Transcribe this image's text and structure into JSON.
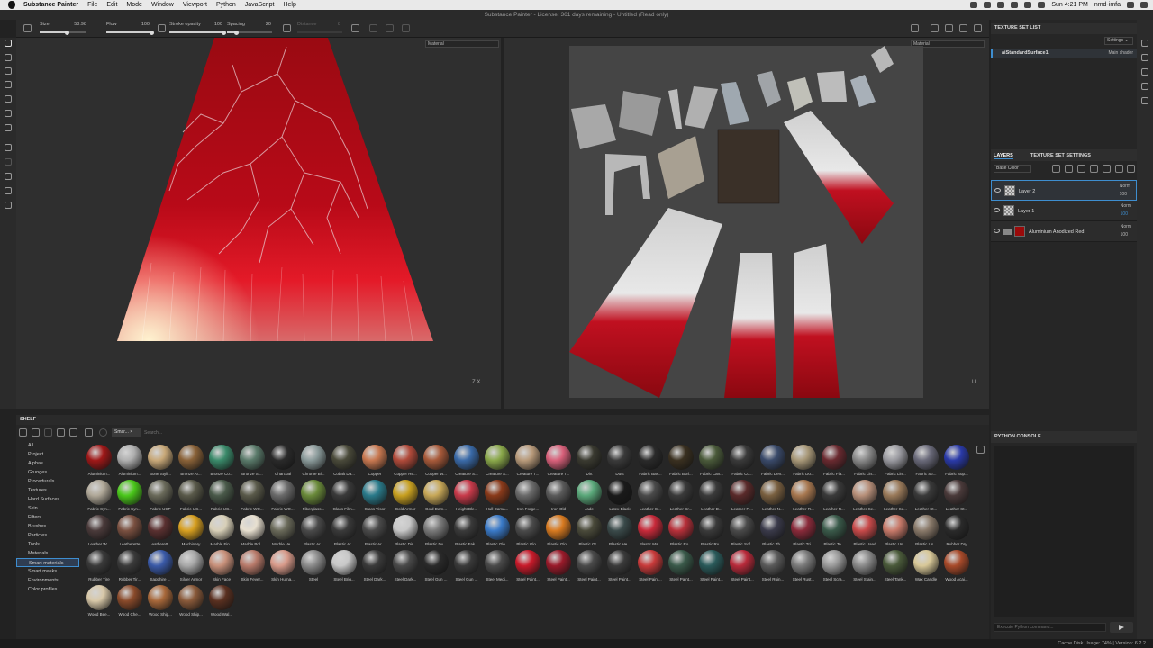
{
  "os_menu": {
    "app": "Substance Painter",
    "items": [
      "File",
      "Edit",
      "Mode",
      "Window",
      "Viewport",
      "Python",
      "JavaScript",
      "Help"
    ],
    "clock": "Sun 4:21 PM",
    "user": "nmd-imfa"
  },
  "window_title": "Substance Painter - License: 361 days remaining - Untitled (Read only)",
  "toolbar": {
    "size_label": "Size",
    "size_value": "58.98",
    "size_level": 0.58,
    "flow_label": "Flow",
    "flow_value": "100",
    "flow_level": 1.0,
    "stroke_label": "Stroke opacity",
    "stroke_value": "100",
    "stroke_level": 1.0,
    "spacing_label": "Spacing",
    "spacing_value": "20",
    "spacing_level": 0.2,
    "distance_label": "Distance",
    "distance_value": "8"
  },
  "viewport3d": {
    "dropdown": "Material",
    "axes": "Z  X"
  },
  "viewport2d": {
    "dropdown": "Material",
    "axes": "U"
  },
  "texture_set_list": {
    "title": "TEXTURE SET LIST",
    "settings": "Settings ⌄",
    "item": "aiStandardSurface1",
    "shader": "Main shader"
  },
  "layers_panel": {
    "tab_layers": "LAYERS",
    "tab_settings": "TEXTURE SET SETTINGS",
    "channel": "Base Color",
    "layers": [
      {
        "name": "Layer 2",
        "blend": "Norm",
        "opacity": "100"
      },
      {
        "name": "Layer 1",
        "blend": "Norm",
        "opacity": "100"
      },
      {
        "name": "Aluminium Anodized Red",
        "blend": "Norm",
        "opacity": "100"
      }
    ]
  },
  "python_console": {
    "title": "PYTHON CONSOLE",
    "placeholder": "Execute Python command..."
  },
  "shelf": {
    "title": "SHELF",
    "filter_tag": "Smar...",
    "search_placeholder": "Search...",
    "categories": [
      "All",
      "Project",
      "Alphas",
      "Grunges",
      "Procedurals",
      "Textures",
      "Hard Surfaces",
      "Skin",
      "Filters",
      "Brushes",
      "Particles",
      "Tools",
      "Materials",
      "Smart materials",
      "Smart masks",
      "Environments",
      "Color profiles"
    ],
    "selected_category": "Smart materials",
    "materials": [
      [
        "Aluminium...",
        "#a01818"
      ],
      [
        "Aluminium...",
        "#b0b0b0"
      ],
      [
        "Bone Styli...",
        "#c8a878"
      ],
      [
        "Bronze Ar...",
        "#8a6238"
      ],
      [
        "Bronze Co...",
        "#3a8a6a"
      ],
      [
        "Bronze St...",
        "#5a7a6a"
      ],
      [
        "Charcoal",
        "#2a2a2a"
      ],
      [
        "Chrome Bl...",
        "#8a9a9a"
      ],
      [
        "Cobalt Da...",
        "#4a4a3a"
      ],
      [
        "Copper",
        "#c87850"
      ],
      [
        "Copper Re...",
        "#b04a3a"
      ],
      [
        "Copper W...",
        "#a85a3a"
      ],
      [
        "Creature S...",
        "#3a6aa8"
      ],
      [
        "Creature S...",
        "#8aa84a"
      ],
      [
        "Creature T...",
        "#b89a7a"
      ],
      [
        "Creature T...",
        "#d8607a"
      ],
      [
        "Dirt",
        "#3a3a30"
      ],
      [
        "Dust",
        "#3a3a3a"
      ],
      [
        "Fabric Bas...",
        "#2a2a2a"
      ],
      [
        "Fabric Burl...",
        "#3a3020"
      ],
      [
        "Fabric Can...",
        "#4a5a3a"
      ],
      [
        "Fabric Co...",
        "#3a3a3a"
      ],
      [
        "Fabric Den...",
        "#3a4a6a"
      ],
      [
        "Fabric Do...",
        "#a89878"
      ],
      [
        "Fabric Fla...",
        "#6a2a30"
      ],
      [
        "Fabric Lin...",
        "#8a8a8a"
      ],
      [
        "Fabric Lin...",
        "#9a9aa0"
      ],
      [
        "Fabric Str...",
        "#6a6a7a"
      ],
      [
        "Fabric Sup...",
        "#2a3aa8"
      ],
      [
        "Fabric Syn...",
        "#b0a898"
      ],
      [
        "Fabric Syn...",
        "#4ac81a"
      ],
      [
        "Fabric UCP",
        "#6a6a5a"
      ],
      [
        "Fabric UC...",
        "#5a5a4a"
      ],
      [
        "Fabric UC...",
        "#4a5a4a"
      ],
      [
        "Fabric WO...",
        "#5a5a4a"
      ],
      [
        "Fabric WO...",
        "#6a6a6a"
      ],
      [
        "Fiberglass...",
        "#6a8a3a"
      ],
      [
        "Glass Film...",
        "#3a3a3a"
      ],
      [
        "Glass Visor",
        "#2a7a8a"
      ],
      [
        "Gold Armor",
        "#c8a020"
      ],
      [
        "Gold Dam...",
        "#c8a858"
      ],
      [
        "Height Ble...",
        "#c83a4a"
      ],
      [
        "Hull Dama...",
        "#8a3a1a"
      ],
      [
        "Iron Forge...",
        "#6a6a6a"
      ],
      [
        "Iron Old",
        "#5a5a5a"
      ],
      [
        "Jade",
        "#5aa87a"
      ],
      [
        "Latex Black",
        "#1a1a1a"
      ],
      [
        "Leather C...",
        "#4a4a4a"
      ],
      [
        "Leather Cr...",
        "#3a3a3a"
      ],
      [
        "Leather D...",
        "#3a3a3a"
      ],
      [
        "Leather Fi...",
        "#5a2a2a"
      ],
      [
        "Leather N...",
        "#7a6040"
      ],
      [
        "Leather R...",
        "#a87850"
      ],
      [
        "Leather R...",
        "#3a3a3a"
      ],
      [
        "Leather Se...",
        "#b8907a"
      ],
      [
        "Leather Se...",
        "#9a7a5a"
      ],
      [
        "Leather St...",
        "#3a3a3a"
      ],
      [
        "Leather St...",
        "#4a3a3a"
      ],
      [
        "Leather W...",
        "#4a3a3a"
      ],
      [
        "Leatherette",
        "#7a5040"
      ],
      [
        "Leatherett...",
        "#5a3030"
      ],
      [
        "Machinery",
        "#d8a020"
      ],
      [
        "Marble Fin...",
        "#d8d0b8"
      ],
      [
        "Marble Pol...",
        "#e8e0d0"
      ],
      [
        "Marble Ve...",
        "#6a6a5a"
      ],
      [
        "Plastic Ar...",
        "#4a4a4a"
      ],
      [
        "Plastic Ar...",
        "#3a3a3a"
      ],
      [
        "Plastic Ar...",
        "#4a4a4a"
      ],
      [
        "Plastic Dir...",
        "#c8c8c8"
      ],
      [
        "Plastic Du...",
        "#7a7a7a"
      ],
      [
        "Plastic Fak...",
        "#3a3a3a"
      ],
      [
        "Plastic Glo...",
        "#3a7ac8"
      ],
      [
        "Plastic Glo...",
        "#4a4a4a"
      ],
      [
        "Plastic Glo...",
        "#d87a20"
      ],
      [
        "Plastic Gr...",
        "#4a4a3a"
      ],
      [
        "Plastic He...",
        "#3a4a4a"
      ],
      [
        "Plastic Ma...",
        "#c82a3a"
      ],
      [
        "Plastic Ro...",
        "#b8303a"
      ],
      [
        "Plastic Ru...",
        "#3a3a3a"
      ],
      [
        "Plastic Sof...",
        "#4a4a4a"
      ],
      [
        "Plastic Th...",
        "#3a3a4a"
      ],
      [
        "Plastic Tri...",
        "#8a2a3a"
      ],
      [
        "Plastic Te...",
        "#3a5a4a"
      ],
      [
        "Plastic Used",
        "#c84a4a"
      ],
      [
        "Plastic Us...",
        "#c87a6a"
      ],
      [
        "Plastic Us...",
        "#8a7a6a"
      ],
      [
        "Rubber Dry",
        "#2a2a2a"
      ],
      [
        "Rubber Tire",
        "#3a3a3a"
      ],
      [
        "Rubber Tir...",
        "#3a3a3a"
      ],
      [
        "Sapphire ...",
        "#3a5aa8"
      ],
      [
        "Silver Armor",
        "#a8a8a8"
      ],
      [
        "Skin Face",
        "#c8907a"
      ],
      [
        "Skin Fever...",
        "#b87a6a"
      ],
      [
        "Skin Huma...",
        "#d89a8a"
      ],
      [
        "Steel",
        "#8a8a8a"
      ],
      [
        "Steel Brig...",
        "#c8c8c8"
      ],
      [
        "Steel Dark...",
        "#3a3a3a"
      ],
      [
        "Steel Dark...",
        "#4a4a4a"
      ],
      [
        "Steel Gun ...",
        "#2a2a2a"
      ],
      [
        "Steel Gun ...",
        "#3a3a3a"
      ],
      [
        "Steel Medi...",
        "#4a4a4a"
      ],
      [
        "Steel Paint...",
        "#c81a2a"
      ],
      [
        "Steel Paint...",
        "#9a1a2a"
      ],
      [
        "Steel Paint...",
        "#4a4a4a"
      ],
      [
        "Steel Paint...",
        "#3a3a3a"
      ],
      [
        "Steel Paint...",
        "#c83a3a"
      ],
      [
        "Steel Paint...",
        "#3a5a4a"
      ],
      [
        "Steel Paint...",
        "#2a5a5a"
      ],
      [
        "Steel Paint...",
        "#b82a3a"
      ],
      [
        "Steel Ruin...",
        "#5a5a5a"
      ],
      [
        "Steel Rust...",
        "#7a7a7a"
      ],
      [
        "Steel Scra...",
        "#9a9a9a"
      ],
      [
        "Steel Stain...",
        "#8a8a8a"
      ],
      [
        "Steel Tank...",
        "#4a5a3a"
      ],
      [
        "Wax Candle",
        "#d8c898"
      ],
      [
        "Wood Acaj...",
        "#a84a2a"
      ],
      [
        "Wood Bee...",
        "#d8c8a8"
      ],
      [
        "Wood Che...",
        "#8a4a2a"
      ],
      [
        "Wood Ship...",
        "#a8683a"
      ],
      [
        "Wood Ship...",
        "#8a5a3a"
      ],
      [
        "Wood Wal...",
        "#5a3020"
      ]
    ]
  },
  "status": {
    "text": "Cache Disk Usage:    74% | Version: 6.2.2"
  }
}
